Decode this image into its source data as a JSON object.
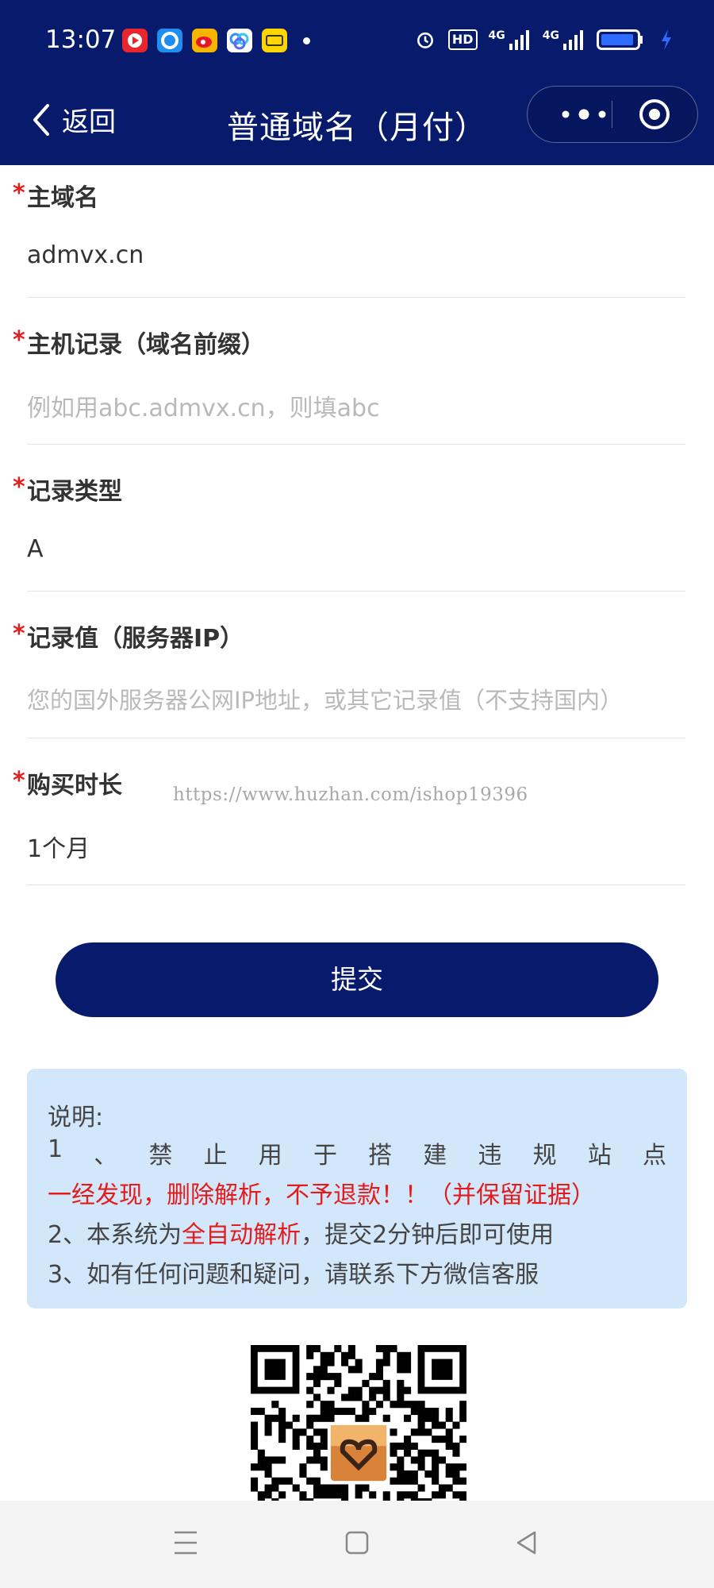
{
  "status_bar": {
    "time": "13:07",
    "network_1": "4G",
    "network_2": "4G",
    "hd": "HD"
  },
  "nav": {
    "back_label": "返回",
    "title": "普通域名（月付）"
  },
  "form": {
    "fields": [
      {
        "label": "主域名",
        "value": "admvx.cn",
        "placeholder": ""
      },
      {
        "label": "主机记录（域名前缀）",
        "value": "",
        "placeholder": "例如用abc.admvx.cn，则填abc"
      },
      {
        "label": "记录类型",
        "value": "A",
        "placeholder": ""
      },
      {
        "label": "记录值（服务器IP）",
        "value": "",
        "placeholder": "您的国外服务器公网IP地址，或其它记录值（不支持国内）"
      },
      {
        "label": "购买时长",
        "value": "1个月",
        "placeholder": ""
      }
    ],
    "required_mark": "*",
    "submit_label": "提交"
  },
  "watermark": "https://www.huzhan.com/ishop19396",
  "notice": {
    "title": "说明:",
    "line1_chars": [
      "1",
      "、",
      "禁",
      "止",
      "用",
      "于",
      "搭",
      "建",
      "违",
      "规",
      "站",
      "点"
    ],
    "line1_red": "一经发现，删除解析，不予退款！！（并保留证据）",
    "line2_prefix": "2、本系统为",
    "line2_red": "全自动解析",
    "line2_suffix": "，提交2分钟后即可使用",
    "line3": "3、如有任何问题和疑问，请联系下方微信客服"
  },
  "colors": {
    "primary": "#071a6b",
    "notice_bg": "#d3e7fb",
    "required": "#e02020",
    "warning": "#e31b1b"
  },
  "icons": {
    "back": "chevron-left-icon",
    "more": "more-dots-icon",
    "close": "target-close-icon",
    "menu": "menu-icon",
    "home": "home-square-icon",
    "back_nav": "triangle-back-icon"
  }
}
